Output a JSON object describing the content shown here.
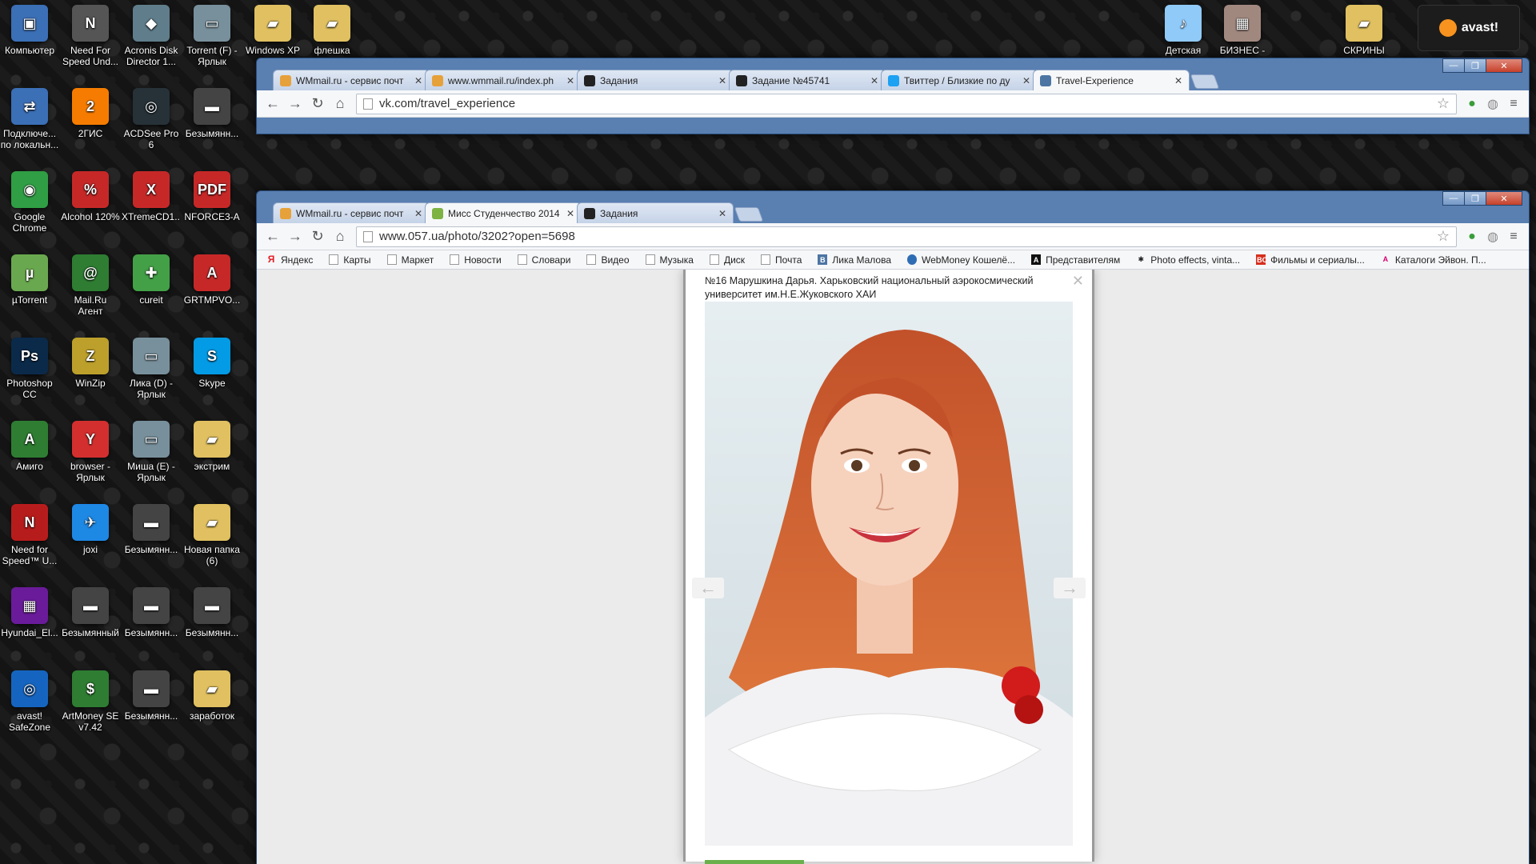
{
  "desktop": {
    "col1": [
      {
        "label": "Компьютер",
        "color": "#3b6fb6",
        "glyph": "▣"
      },
      {
        "label": "Подключе... по локальн...",
        "color": "#3b6fb6",
        "glyph": "⇄"
      },
      {
        "label": "Google Chrome",
        "color": "#2f9e44",
        "glyph": "◉"
      },
      {
        "label": "µTorrent",
        "color": "#6aa84f",
        "glyph": "µ"
      },
      {
        "label": "Photoshop CC",
        "color": "#0b2a4a",
        "glyph": "Ps"
      },
      {
        "label": "Амиго",
        "color": "#2e7d32",
        "glyph": "A"
      },
      {
        "label": "Need for Speed™ U...",
        "color": "#b71c1c",
        "glyph": "N"
      },
      {
        "label": "Hyundai_El...",
        "color": "#6a1b9a",
        "glyph": "▦"
      },
      {
        "label": "avast! SafeZone",
        "color": "#1565c0",
        "glyph": "◎"
      }
    ],
    "col2": [
      {
        "label": "Need For Speed Und...",
        "color": "#555555",
        "glyph": "N"
      },
      {
        "label": "2ГИС",
        "color": "#f57c00",
        "glyph": "2"
      },
      {
        "label": "Alcohol 120%",
        "color": "#c62828",
        "glyph": "%"
      },
      {
        "label": "Mail.Ru Агент",
        "color": "#2e7d32",
        "glyph": "@"
      },
      {
        "label": "WinZip",
        "color": "#bca02b",
        "glyph": "Z"
      },
      {
        "label": "browser - Ярлык",
        "color": "#d32f2f",
        "glyph": "Y"
      },
      {
        "label": "joxi",
        "color": "#1e88e5",
        "glyph": "✈"
      },
      {
        "label": "Безымянный",
        "color": "#444444",
        "glyph": "▬"
      },
      {
        "label": "ArtMoney SE v7.42",
        "color": "#2e7d32",
        "glyph": "$"
      }
    ],
    "col3": [
      {
        "label": "Acronis Disk Director 1...",
        "color": "#607d8b",
        "glyph": "◆"
      },
      {
        "label": "ACDSee Pro 6",
        "color": "#263238",
        "glyph": "◎"
      },
      {
        "label": "XTremeCD1...",
        "color": "#c62828",
        "glyph": "X"
      },
      {
        "label": "cureit",
        "color": "#43a047",
        "glyph": "✚"
      },
      {
        "label": "Лика (D) - Ярлык",
        "color": "#78909c",
        "glyph": "▭"
      },
      {
        "label": "Миша (E) - Ярлык",
        "color": "#78909c",
        "glyph": "▭"
      },
      {
        "label": "Безымянн...",
        "color": "#444444",
        "glyph": "▬"
      },
      {
        "label": "Безымянн...",
        "color": "#444444",
        "glyph": "▬"
      },
      {
        "label": "Безымянн...",
        "color": "#444444",
        "glyph": "▬"
      }
    ],
    "col4": [
      {
        "label": "Torrent (F) - Ярлык",
        "color": "#78909c",
        "glyph": "▭"
      },
      {
        "label": "Безымянн...",
        "color": "#444444",
        "glyph": "▬"
      },
      {
        "label": "NFORCE3-A",
        "color": "#c62828",
        "glyph": "PDF"
      },
      {
        "label": "GRTMPVO...",
        "color": "#c62828",
        "glyph": "A"
      },
      {
        "label": "Skype",
        "color": "#039be5",
        "glyph": "S"
      },
      {
        "label": "экстрим",
        "color": "#e0c060",
        "glyph": "▰"
      },
      {
        "label": "Новая папка (6)",
        "color": "#e0c060",
        "glyph": "▰"
      },
      {
        "label": "Безымянн...",
        "color": "#444444",
        "glyph": "▬"
      },
      {
        "label": "заработок",
        "color": "#e0c060",
        "glyph": "▰"
      }
    ],
    "top_row": [
      {
        "label": "Windows XP P",
        "color": "#e0c060",
        "glyph": "▰"
      },
      {
        "label": "флешка",
        "color": "#e0c060",
        "glyph": "▰"
      },
      {
        "label": "Детская",
        "color": "#90caf9",
        "glyph": "♪"
      },
      {
        "label": "БИЗНЕС -",
        "color": "#a1887f",
        "glyph": "▦"
      },
      {
        "label": "СКРИНЫ",
        "color": "#e0c060",
        "glyph": "▰"
      }
    ],
    "avast_label": "avast!"
  },
  "back_window": {
    "tabs": [
      {
        "title": "WMmail.ru - сервис почт",
        "color": "#e7a13a"
      },
      {
        "title": "www.wmmail.ru/index.ph",
        "color": "#e7a13a"
      },
      {
        "title": "Задания",
        "color": "#222222"
      },
      {
        "title": "Задание №45741",
        "color": "#222222"
      },
      {
        "title": "Твиттер / Близкие по ду",
        "color": "#1da1f2"
      },
      {
        "title": "Travel-Experience",
        "color": "#4c75a3"
      }
    ],
    "url": "vk.com/travel_experience"
  },
  "front_window": {
    "tabs": [
      {
        "title": "WMmail.ru - сервис почт",
        "color": "#e7a13a"
      },
      {
        "title": "Мисс Студенчество 2014",
        "color": "#7cb342"
      },
      {
        "title": "Задания",
        "color": "#222222"
      }
    ],
    "url": "www.057.ua/photo/3202?open=5698"
  },
  "bookmarks": [
    {
      "label": "Яндекс",
      "icon": "y"
    },
    {
      "label": "Карты",
      "icon": "page"
    },
    {
      "label": "Маркет",
      "icon": "page"
    },
    {
      "label": "Новости",
      "icon": "page"
    },
    {
      "label": "Словари",
      "icon": "page"
    },
    {
      "label": "Видео",
      "icon": "page"
    },
    {
      "label": "Музыка",
      "icon": "page"
    },
    {
      "label": "Диск",
      "icon": "page"
    },
    {
      "label": "Почта",
      "icon": "mail"
    },
    {
      "label": "Лика Малова",
      "icon": "vk"
    },
    {
      "label": "WebMoney Кошелё...",
      "icon": "wm"
    },
    {
      "label": "Представителям",
      "icon": "dark"
    },
    {
      "label": "Photo effects, vinta...",
      "icon": "star"
    },
    {
      "label": "Фильмы и сериалы...",
      "icon": "bc"
    },
    {
      "label": "Каталоги Эйвон. П...",
      "icon": "av"
    }
  ],
  "overlay": {
    "caption": "№16 Марушкина Дарья. Харьковский национальный аэрокосмический университет им.Н.Е.Жуковского ХАИ"
  }
}
